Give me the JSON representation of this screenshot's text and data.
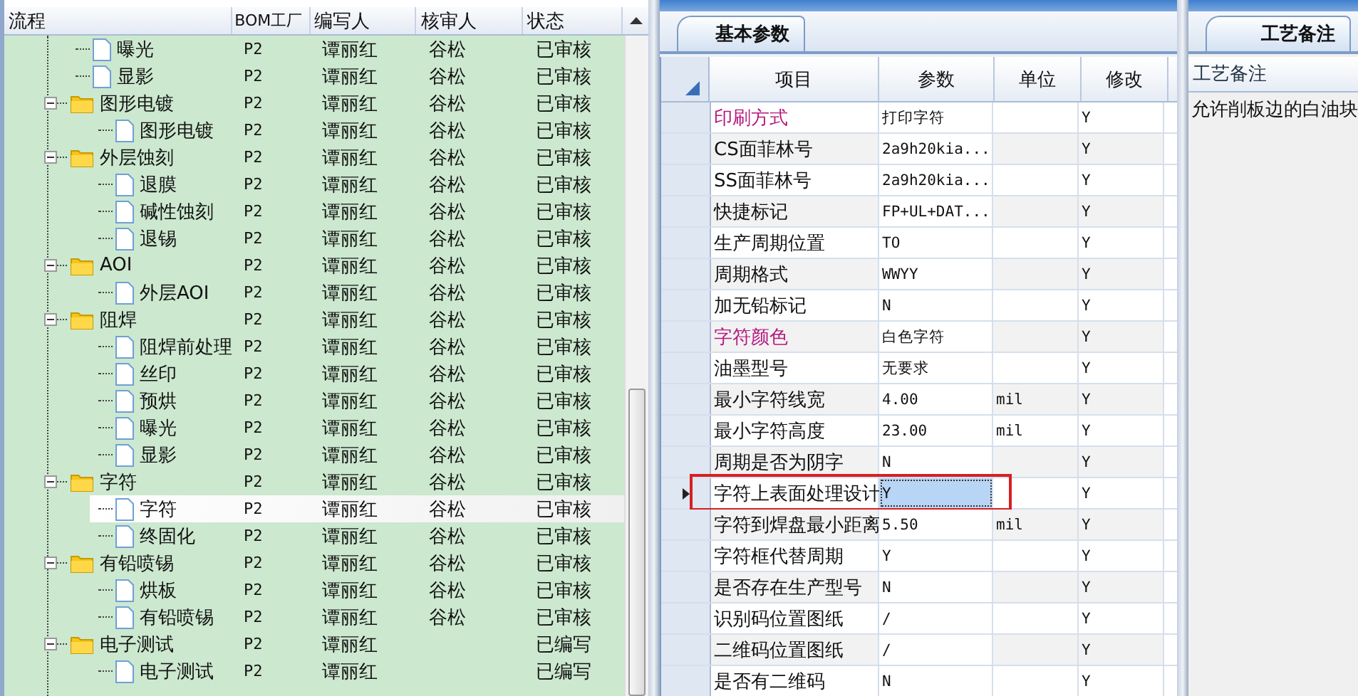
{
  "tree": {
    "columns": [
      "流程",
      "BOM工厂",
      "编写人",
      "核审人",
      "状态"
    ],
    "nodes": [
      {
        "kind": "file",
        "label": "曝光",
        "cells": [
          "P2",
          "谭丽红",
          "谷松",
          "已审核"
        ],
        "selected": false
      },
      {
        "kind": "file",
        "label": "显影",
        "cells": [
          "P2",
          "谭丽红",
          "谷松",
          "已审核"
        ],
        "selected": false
      },
      {
        "kind": "folder",
        "label": "图形电镀",
        "cells": [
          "P2",
          "谭丽红",
          "谷松",
          "已审核"
        ],
        "selected": false,
        "expanded": true,
        "children": [
          {
            "kind": "file",
            "label": "图形电镀",
            "cells": [
              "P2",
              "谭丽红",
              "谷松",
              "已审核"
            ],
            "selected": false
          }
        ]
      },
      {
        "kind": "folder",
        "label": "外层蚀刻",
        "cells": [
          "P2",
          "谭丽红",
          "谷松",
          "已审核"
        ],
        "selected": false,
        "expanded": true,
        "children": [
          {
            "kind": "file",
            "label": "退膜",
            "cells": [
              "P2",
              "谭丽红",
              "谷松",
              "已审核"
            ],
            "selected": false
          },
          {
            "kind": "file",
            "label": "碱性蚀刻",
            "cells": [
              "P2",
              "谭丽红",
              "谷松",
              "已审核"
            ],
            "selected": false
          },
          {
            "kind": "file",
            "label": "退锡",
            "cells": [
              "P2",
              "谭丽红",
              "谷松",
              "已审核"
            ],
            "selected": false
          }
        ]
      },
      {
        "kind": "folder",
        "label": "AOI",
        "cells": [
          "P2",
          "谭丽红",
          "谷松",
          "已审核"
        ],
        "selected": false,
        "expanded": true,
        "children": [
          {
            "kind": "file",
            "label": "外层AOI",
            "cells": [
              "P2",
              "谭丽红",
              "谷松",
              "已审核"
            ],
            "selected": false
          }
        ]
      },
      {
        "kind": "folder",
        "label": "阻焊",
        "cells": [
          "P2",
          "谭丽红",
          "谷松",
          "已审核"
        ],
        "selected": false,
        "expanded": true,
        "children": [
          {
            "kind": "file",
            "label": "阻焊前处理",
            "cells": [
              "P2",
              "谭丽红",
              "谷松",
              "已审核"
            ],
            "selected": false
          },
          {
            "kind": "file",
            "label": "丝印",
            "cells": [
              "P2",
              "谭丽红",
              "谷松",
              "已审核"
            ],
            "selected": false
          },
          {
            "kind": "file",
            "label": "预烘",
            "cells": [
              "P2",
              "谭丽红",
              "谷松",
              "已审核"
            ],
            "selected": false
          },
          {
            "kind": "file",
            "label": "曝光",
            "cells": [
              "P2",
              "谭丽红",
              "谷松",
              "已审核"
            ],
            "selected": false
          },
          {
            "kind": "file",
            "label": "显影",
            "cells": [
              "P2",
              "谭丽红",
              "谷松",
              "已审核"
            ],
            "selected": false
          }
        ]
      },
      {
        "kind": "folder",
        "label": "字符",
        "cells": [
          "P2",
          "谭丽红",
          "谷松",
          "已审核"
        ],
        "selected": false,
        "expanded": true,
        "children": [
          {
            "kind": "file",
            "label": "字符",
            "cells": [
              "P2",
              "谭丽红",
              "谷松",
              "已审核"
            ],
            "selected": true
          },
          {
            "kind": "file",
            "label": "终固化",
            "cells": [
              "P2",
              "谭丽红",
              "谷松",
              "已审核"
            ],
            "selected": false
          }
        ]
      },
      {
        "kind": "folder",
        "label": "有铅喷锡",
        "cells": [
          "P2",
          "谭丽红",
          "谷松",
          "已审核"
        ],
        "selected": false,
        "expanded": true,
        "children": [
          {
            "kind": "file",
            "label": "烘板",
            "cells": [
              "P2",
              "谭丽红",
              "谷松",
              "已审核"
            ],
            "selected": false
          },
          {
            "kind": "file",
            "label": "有铅喷锡",
            "cells": [
              "P2",
              "谭丽红",
              "谷松",
              "已审核"
            ],
            "selected": false
          }
        ]
      },
      {
        "kind": "folder",
        "label": "电子测试",
        "cells": [
          "P2",
          "谭丽红",
          "",
          "已编写"
        ],
        "selected": false,
        "expanded": true,
        "children": [
          {
            "kind": "file",
            "label": "电子测试",
            "cells": [
              "P2",
              "谭丽红",
              "",
              "已编写"
            ],
            "selected": false
          }
        ]
      }
    ]
  },
  "params": {
    "tab": "基本参数",
    "columns": [
      "项目",
      "参数",
      "单位",
      "修改"
    ],
    "rows": [
      {
        "item": "印刷方式",
        "highlight": true,
        "value": "打印字符",
        "unit": "",
        "modify": "Y",
        "selected": false
      },
      {
        "item": "CS面菲林号",
        "highlight": false,
        "value": "2a9h20kia...",
        "unit": "",
        "modify": "Y",
        "selected": false
      },
      {
        "item": "SS面菲林号",
        "highlight": false,
        "value": "2a9h20kia...",
        "unit": "",
        "modify": "Y",
        "selected": false
      },
      {
        "item": "快捷标记",
        "highlight": false,
        "value": "FP+UL+DAT...",
        "unit": "",
        "modify": "Y",
        "selected": false
      },
      {
        "item": "生产周期位置",
        "highlight": false,
        "value": "TO",
        "unit": "",
        "modify": "Y",
        "selected": false
      },
      {
        "item": "周期格式",
        "highlight": false,
        "value": "WWYY",
        "unit": "",
        "modify": "Y",
        "selected": false
      },
      {
        "item": "加无铅标记",
        "highlight": false,
        "value": "N",
        "unit": "",
        "modify": "Y",
        "selected": false
      },
      {
        "item": "字符颜色",
        "highlight": true,
        "value": "白色字符",
        "unit": "",
        "modify": "Y",
        "selected": false
      },
      {
        "item": "油墨型号",
        "highlight": false,
        "value": "无要求",
        "unit": "",
        "modify": "Y",
        "selected": false
      },
      {
        "item": "最小字符线宽",
        "highlight": false,
        "value": "4.00",
        "unit": "mil",
        "modify": "Y",
        "selected": false
      },
      {
        "item": "最小字符高度",
        "highlight": false,
        "value": "23.00",
        "unit": "mil",
        "modify": "Y",
        "selected": false
      },
      {
        "item": "周期是否为阴字",
        "highlight": false,
        "value": "N",
        "unit": "",
        "modify": "Y",
        "selected": false
      },
      {
        "item": "字符上表面处理设计",
        "highlight": false,
        "value": "Y",
        "unit": "",
        "modify": "Y",
        "selected": true
      },
      {
        "item": "字符到焊盘最小距离",
        "highlight": false,
        "value": "5.50",
        "unit": "mil",
        "modify": "Y",
        "selected": false
      },
      {
        "item": "字符框代替周期",
        "highlight": false,
        "value": "Y",
        "unit": "",
        "modify": "Y",
        "selected": false
      },
      {
        "item": "是否存在生产型号",
        "highlight": false,
        "value": "N",
        "unit": "",
        "modify": "Y",
        "selected": false
      },
      {
        "item": "识别码位置图纸",
        "highlight": false,
        "value": "/",
        "unit": "",
        "modify": "Y",
        "selected": false
      },
      {
        "item": "二维码位置图纸",
        "highlight": false,
        "value": "/",
        "unit": "",
        "modify": "Y",
        "selected": false
      },
      {
        "item": "是否有二维码",
        "highlight": false,
        "value": "N",
        "unit": "",
        "modify": "Y",
        "selected": false
      }
    ]
  },
  "notes": {
    "tab": "工艺备注",
    "column": "工艺备注",
    "text": "允许削板边的白油块"
  }
}
